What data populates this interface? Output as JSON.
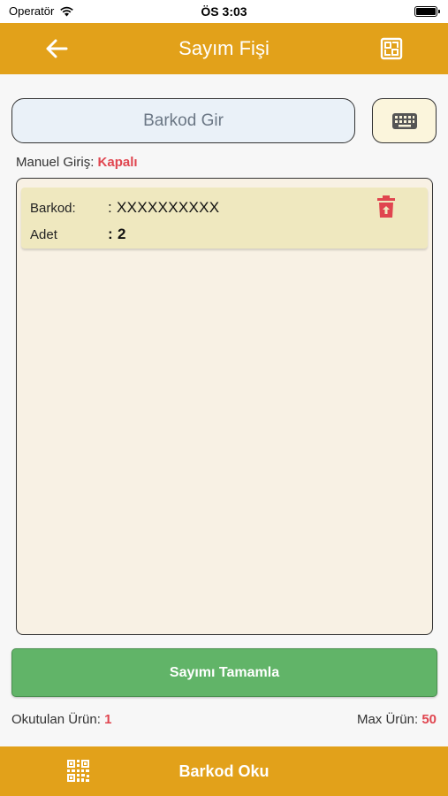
{
  "status_bar": {
    "carrier": "Operatör",
    "time": "ÖS 3:03"
  },
  "header": {
    "title": "Sayım Fişi",
    "back_icon": "arrow-left-icon",
    "action_icon": "scan-frame-icon"
  },
  "search": {
    "placeholder": "Barkod Gir",
    "value": "",
    "keyboard_icon": "keyboard-icon"
  },
  "manual_entry": {
    "label": "Manuel Giriş:",
    "state": "Kapalı"
  },
  "items": [
    {
      "barcode_label": "Barkod:",
      "barcode_value": ": XXXXXXXXXX",
      "qty_label": "Adet",
      "qty_value": ": 2",
      "delete_icon": "trash-icon"
    }
  ],
  "complete_button": {
    "label": "Sayımı Tamamla"
  },
  "counters": {
    "read_label": "Okutulan Ürün:",
    "read_value": "1",
    "max_label": "Max Ürün:",
    "max_value": "50"
  },
  "bottom_bar": {
    "label": "Barkod Oku",
    "icon": "qr-code-icon"
  },
  "colors": {
    "accent": "#e2a11a",
    "success": "#61b468",
    "danger": "#e0454f"
  }
}
